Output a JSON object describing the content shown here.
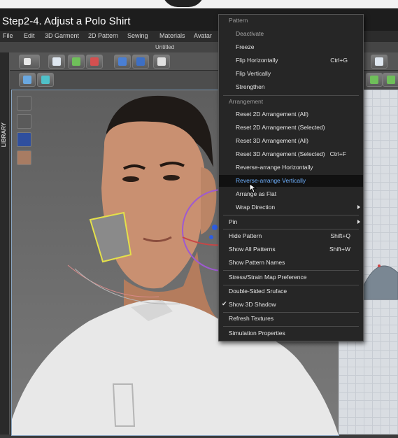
{
  "video_title": "Step2-4. Adjust a Polo Shirt",
  "menubar": [
    "File",
    "Edit",
    "3D Garment",
    "2D Pattern",
    "Sewing",
    "Materials",
    "Avatar"
  ],
  "document_title": "Untitled",
  "library_label": "LIBRARY",
  "context_menu": {
    "pattern_header": "Pattern",
    "deactivate": "Deactivate",
    "freeze": "Freeze",
    "flip_h": "Flip Horizontally",
    "flip_h_sc": "Ctrl+G",
    "flip_v": "Flip Vertically",
    "strengthen": "Strengthen",
    "arrangement_header": "Arrangement",
    "reset_2d_all": "Reset 2D Arrangement (All)",
    "reset_2d_sel": "Reset 2D Arrangement (Selected)",
    "reset_3d_all": "Reset 3D Arrangement (All)",
    "reset_3d_sel": "Reset 3D Arrangement (Selected)",
    "reset_3d_sel_sc": "Ctrl+F",
    "rev_h": "Reverse-arrange Horizontally",
    "rev_v": "Reverse-arrange Vertically",
    "arrange_flat": "Arrange as Flat",
    "wrap_dir": "Wrap Direction",
    "pin": "Pin",
    "hide_pattern": "Hide Pattern",
    "hide_pattern_sc": "Shift+Q",
    "show_all": "Show All Patterns",
    "show_all_sc": "Shift+W",
    "show_names": "Show Pattern Names",
    "stress": "Stress/Strain Map Preference",
    "double_sided": "Double-Sided Sruface",
    "show_shadow": "Show 3D Shadow",
    "shadow_checked": "✔",
    "refresh": "Refresh Textures",
    "sim_props": "Simulation Properties"
  }
}
